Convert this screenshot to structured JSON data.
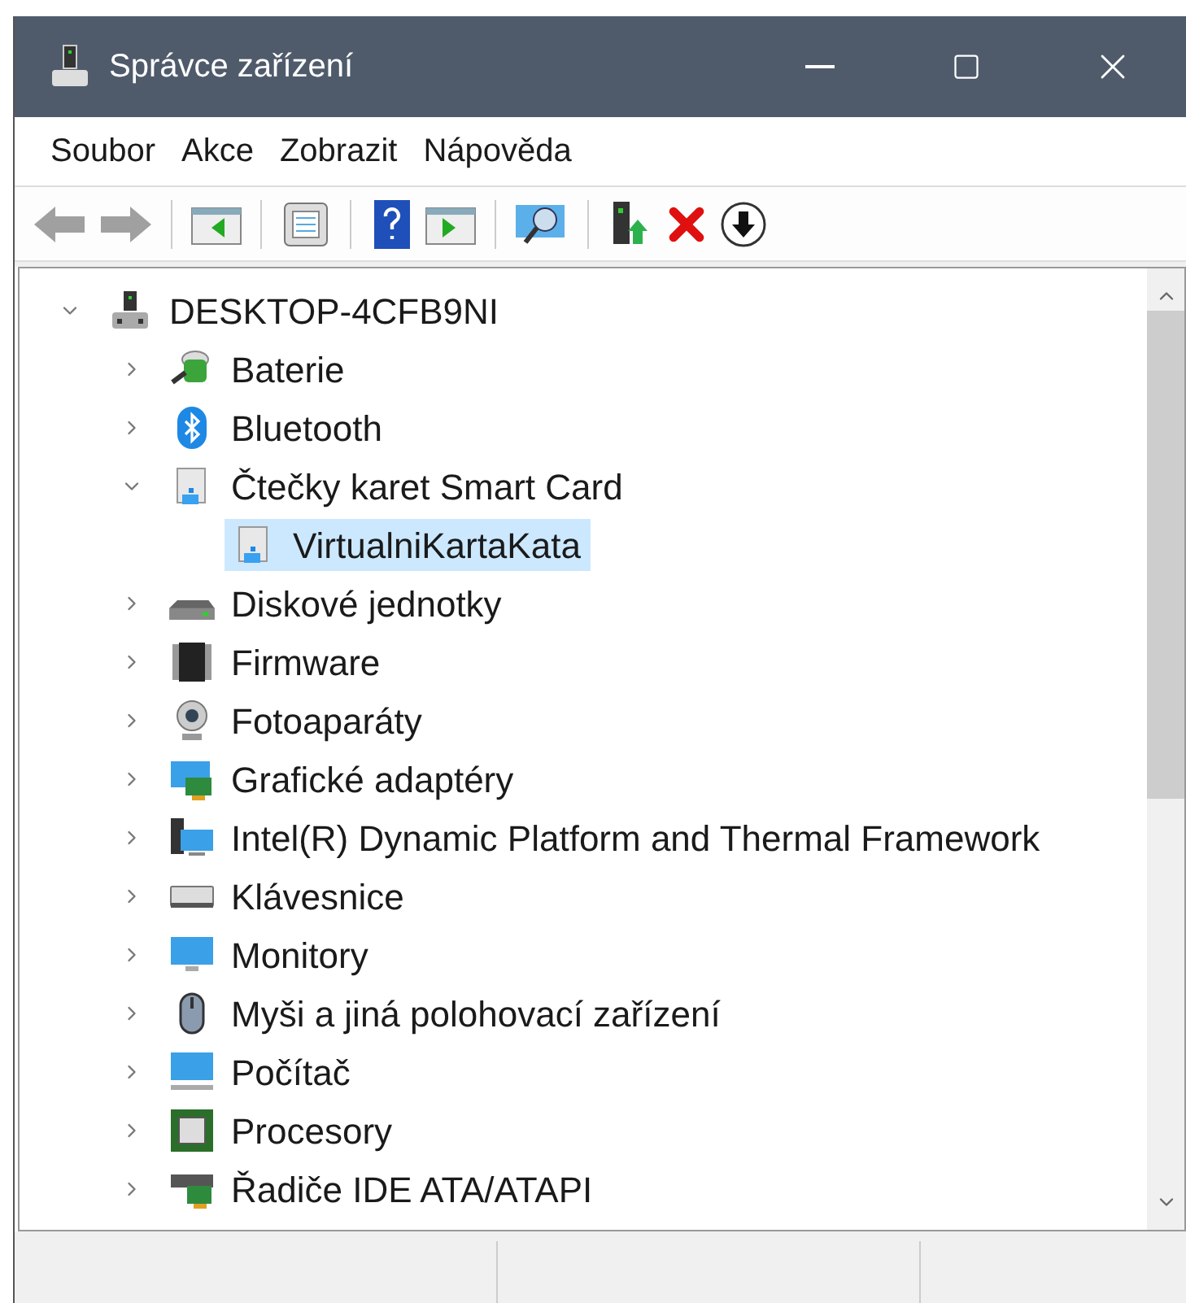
{
  "window": {
    "title": "Správce zařízení"
  },
  "menu": [
    "Soubor",
    "Akce",
    "Zobrazit",
    "Nápověda"
  ],
  "toolbar": [
    {
      "kind": "back",
      "disabled": true
    },
    {
      "kind": "forward",
      "disabled": true
    },
    {
      "kind": "sep"
    },
    {
      "kind": "tree"
    },
    {
      "kind": "sep"
    },
    {
      "kind": "properties"
    },
    {
      "kind": "sep"
    },
    {
      "kind": "help"
    },
    {
      "kind": "pane"
    },
    {
      "kind": "sep"
    },
    {
      "kind": "scan"
    },
    {
      "kind": "sep"
    },
    {
      "kind": "update"
    },
    {
      "kind": "remove"
    },
    {
      "kind": "download"
    }
  ],
  "tree": {
    "label": "DESKTOP-4CFB9NI",
    "expanded": true,
    "selected": false,
    "children": [
      {
        "label": "Baterie",
        "expanded": false,
        "selected": false
      },
      {
        "label": "Bluetooth",
        "expanded": false,
        "selected": false
      },
      {
        "label": "Čtečky karet Smart Card",
        "expanded": true,
        "selected": false,
        "children": [
          {
            "label": "VirtualniKartaKata",
            "selected": true
          }
        ]
      },
      {
        "label": "Diskové jednotky",
        "expanded": false,
        "selected": false
      },
      {
        "label": "Firmware",
        "expanded": false,
        "selected": false
      },
      {
        "label": "Fotoaparáty",
        "expanded": false,
        "selected": false
      },
      {
        "label": "Grafické adaptéry",
        "expanded": false,
        "selected": false
      },
      {
        "label": "Intel(R) Dynamic Platform and Thermal Framework",
        "expanded": false,
        "selected": false
      },
      {
        "label": "Klávesnice",
        "expanded": false,
        "selected": false
      },
      {
        "label": "Monitory",
        "expanded": false,
        "selected": false
      },
      {
        "label": "Myši a jiná polohovací zařízení",
        "expanded": false,
        "selected": false
      },
      {
        "label": "Počítač",
        "expanded": false,
        "selected": false
      },
      {
        "label": "Procesory",
        "expanded": false,
        "selected": false
      },
      {
        "label": "Řadiče IDE ATA/ATAPI",
        "expanded": false,
        "selected": false
      }
    ]
  }
}
